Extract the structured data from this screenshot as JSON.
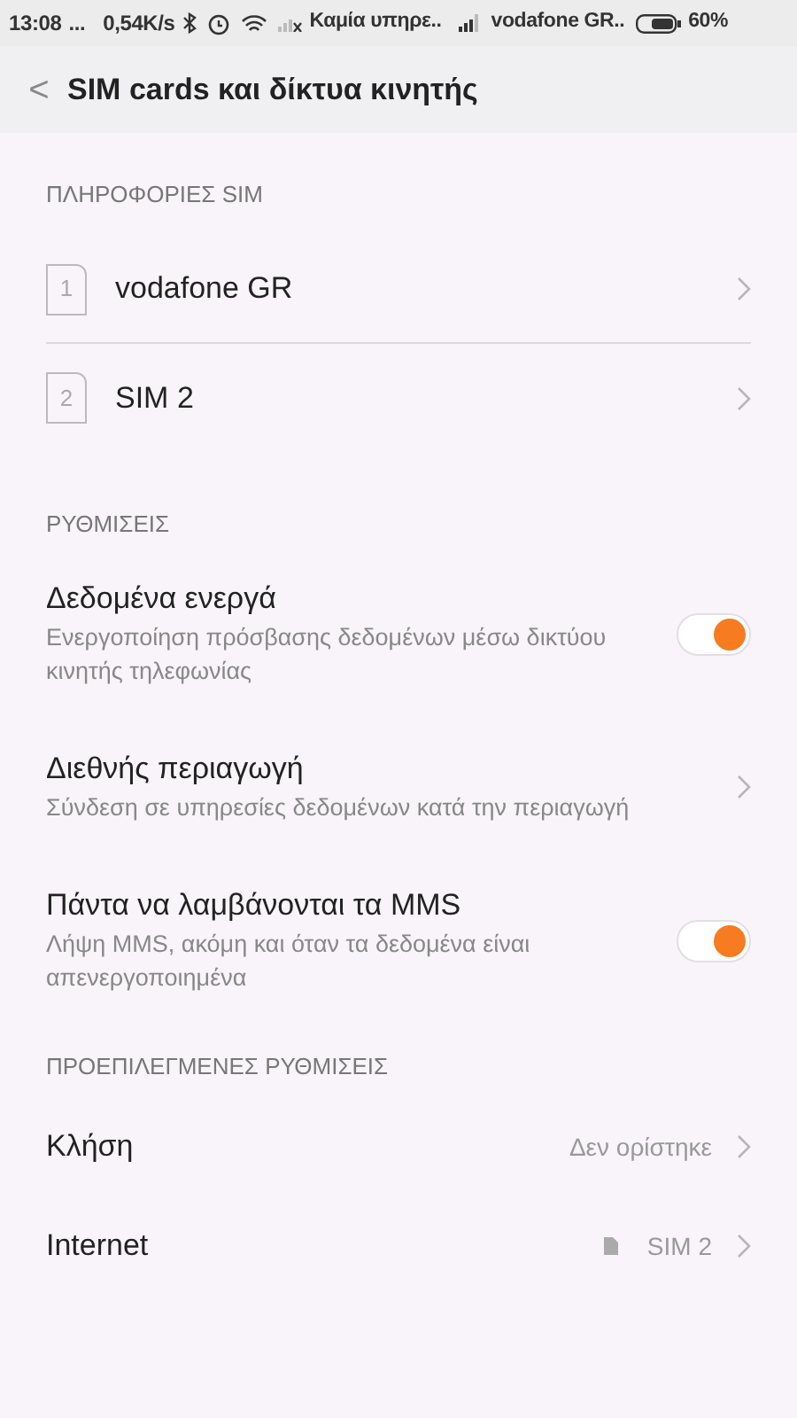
{
  "status_bar": {
    "time": "13:08",
    "dots": "...",
    "speed": "0,54K/s",
    "carrier_1": "Καμία υπηρε..",
    "carrier_2": "vodafone GR..",
    "battery": "60%"
  },
  "header": {
    "back": "<",
    "title": "SIM cards και δίκτυα κινητής"
  },
  "sections": [
    {
      "title": "ΠΛΗΡΟΦΟΡΙΕΣ SIM",
      "items": [
        {
          "kind": "sim",
          "number": "1",
          "label": "vodafone GR"
        },
        {
          "kind": "sim",
          "number": "2",
          "label": "SIM 2"
        }
      ]
    },
    {
      "title": "ΡΥΘΜΙΣΕΙΣ",
      "items": [
        {
          "kind": "toggle",
          "label": "Δεδομένα ενεργά",
          "subtitle": "Ενεργοποίηση πρόσβασης δεδομένων μέσω δικτύου κινητής τηλεφωνίας",
          "on": true
        },
        {
          "kind": "link",
          "label": "Διεθνής περιαγωγή",
          "subtitle": "Σύνδεση σε υπηρεσίες δεδομένων κατά την περιαγωγή"
        },
        {
          "kind": "toggle",
          "label": "Πάντα να λαμβάνονται τα MMS",
          "subtitle": "Λήψη MMS, ακόμη και όταν τα δεδομένα είναι απενεργοποιημένα",
          "on": true
        }
      ]
    },
    {
      "title": "ΠΡΟΕΠΙΛΕΓΜΕΝΕΣ ΡΥΘΜΙΣΕΙΣ",
      "items": [
        {
          "kind": "value",
          "label": "Κλήση",
          "value": "Δεν ορίστηκε"
        },
        {
          "kind": "value",
          "label": "Internet",
          "value": "SIM 2",
          "sim_icon": true
        }
      ]
    }
  ]
}
